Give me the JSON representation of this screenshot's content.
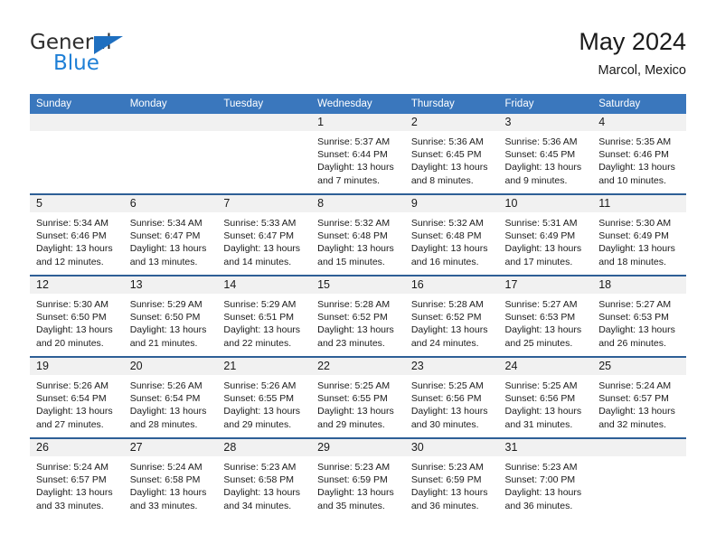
{
  "brand": {
    "name_part1": "General",
    "name_part2": "Blue",
    "triangle_icon": "triangle-logo-icon",
    "color_dark": "#2e2e2e",
    "color_blue": "#1e7fd6"
  },
  "header": {
    "title": "May 2024",
    "subtitle": "Marcol, Mexico"
  },
  "theme": {
    "header_bg": "#3a77bd",
    "row_rule": "#2e5f96",
    "daynum_band": "#f1f1f1",
    "page_bg": "#ffffff",
    "text": "#1a1a1a"
  },
  "weekdays": [
    "Sunday",
    "Monday",
    "Tuesday",
    "Wednesday",
    "Thursday",
    "Friday",
    "Saturday"
  ],
  "weeks": [
    [
      {
        "day": "",
        "sunrise": "",
        "sunset": "",
        "daylight1": "",
        "daylight2": ""
      },
      {
        "day": "",
        "sunrise": "",
        "sunset": "",
        "daylight1": "",
        "daylight2": ""
      },
      {
        "day": "",
        "sunrise": "",
        "sunset": "",
        "daylight1": "",
        "daylight2": ""
      },
      {
        "day": "1",
        "sunrise": "Sunrise: 5:37 AM",
        "sunset": "Sunset: 6:44 PM",
        "daylight1": "Daylight: 13 hours",
        "daylight2": "and 7 minutes."
      },
      {
        "day": "2",
        "sunrise": "Sunrise: 5:36 AM",
        "sunset": "Sunset: 6:45 PM",
        "daylight1": "Daylight: 13 hours",
        "daylight2": "and 8 minutes."
      },
      {
        "day": "3",
        "sunrise": "Sunrise: 5:36 AM",
        "sunset": "Sunset: 6:45 PM",
        "daylight1": "Daylight: 13 hours",
        "daylight2": "and 9 minutes."
      },
      {
        "day": "4",
        "sunrise": "Sunrise: 5:35 AM",
        "sunset": "Sunset: 6:46 PM",
        "daylight1": "Daylight: 13 hours",
        "daylight2": "and 10 minutes."
      }
    ],
    [
      {
        "day": "5",
        "sunrise": "Sunrise: 5:34 AM",
        "sunset": "Sunset: 6:46 PM",
        "daylight1": "Daylight: 13 hours",
        "daylight2": "and 12 minutes."
      },
      {
        "day": "6",
        "sunrise": "Sunrise: 5:34 AM",
        "sunset": "Sunset: 6:47 PM",
        "daylight1": "Daylight: 13 hours",
        "daylight2": "and 13 minutes."
      },
      {
        "day": "7",
        "sunrise": "Sunrise: 5:33 AM",
        "sunset": "Sunset: 6:47 PM",
        "daylight1": "Daylight: 13 hours",
        "daylight2": "and 14 minutes."
      },
      {
        "day": "8",
        "sunrise": "Sunrise: 5:32 AM",
        "sunset": "Sunset: 6:48 PM",
        "daylight1": "Daylight: 13 hours",
        "daylight2": "and 15 minutes."
      },
      {
        "day": "9",
        "sunrise": "Sunrise: 5:32 AM",
        "sunset": "Sunset: 6:48 PM",
        "daylight1": "Daylight: 13 hours",
        "daylight2": "and 16 minutes."
      },
      {
        "day": "10",
        "sunrise": "Sunrise: 5:31 AM",
        "sunset": "Sunset: 6:49 PM",
        "daylight1": "Daylight: 13 hours",
        "daylight2": "and 17 minutes."
      },
      {
        "day": "11",
        "sunrise": "Sunrise: 5:30 AM",
        "sunset": "Sunset: 6:49 PM",
        "daylight1": "Daylight: 13 hours",
        "daylight2": "and 18 minutes."
      }
    ],
    [
      {
        "day": "12",
        "sunrise": "Sunrise: 5:30 AM",
        "sunset": "Sunset: 6:50 PM",
        "daylight1": "Daylight: 13 hours",
        "daylight2": "and 20 minutes."
      },
      {
        "day": "13",
        "sunrise": "Sunrise: 5:29 AM",
        "sunset": "Sunset: 6:50 PM",
        "daylight1": "Daylight: 13 hours",
        "daylight2": "and 21 minutes."
      },
      {
        "day": "14",
        "sunrise": "Sunrise: 5:29 AM",
        "sunset": "Sunset: 6:51 PM",
        "daylight1": "Daylight: 13 hours",
        "daylight2": "and 22 minutes."
      },
      {
        "day": "15",
        "sunrise": "Sunrise: 5:28 AM",
        "sunset": "Sunset: 6:52 PM",
        "daylight1": "Daylight: 13 hours",
        "daylight2": "and 23 minutes."
      },
      {
        "day": "16",
        "sunrise": "Sunrise: 5:28 AM",
        "sunset": "Sunset: 6:52 PM",
        "daylight1": "Daylight: 13 hours",
        "daylight2": "and 24 minutes."
      },
      {
        "day": "17",
        "sunrise": "Sunrise: 5:27 AM",
        "sunset": "Sunset: 6:53 PM",
        "daylight1": "Daylight: 13 hours",
        "daylight2": "and 25 minutes."
      },
      {
        "day": "18",
        "sunrise": "Sunrise: 5:27 AM",
        "sunset": "Sunset: 6:53 PM",
        "daylight1": "Daylight: 13 hours",
        "daylight2": "and 26 minutes."
      }
    ],
    [
      {
        "day": "19",
        "sunrise": "Sunrise: 5:26 AM",
        "sunset": "Sunset: 6:54 PM",
        "daylight1": "Daylight: 13 hours",
        "daylight2": "and 27 minutes."
      },
      {
        "day": "20",
        "sunrise": "Sunrise: 5:26 AM",
        "sunset": "Sunset: 6:54 PM",
        "daylight1": "Daylight: 13 hours",
        "daylight2": "and 28 minutes."
      },
      {
        "day": "21",
        "sunrise": "Sunrise: 5:26 AM",
        "sunset": "Sunset: 6:55 PM",
        "daylight1": "Daylight: 13 hours",
        "daylight2": "and 29 minutes."
      },
      {
        "day": "22",
        "sunrise": "Sunrise: 5:25 AM",
        "sunset": "Sunset: 6:55 PM",
        "daylight1": "Daylight: 13 hours",
        "daylight2": "and 29 minutes."
      },
      {
        "day": "23",
        "sunrise": "Sunrise: 5:25 AM",
        "sunset": "Sunset: 6:56 PM",
        "daylight1": "Daylight: 13 hours",
        "daylight2": "and 30 minutes."
      },
      {
        "day": "24",
        "sunrise": "Sunrise: 5:25 AM",
        "sunset": "Sunset: 6:56 PM",
        "daylight1": "Daylight: 13 hours",
        "daylight2": "and 31 minutes."
      },
      {
        "day": "25",
        "sunrise": "Sunrise: 5:24 AM",
        "sunset": "Sunset: 6:57 PM",
        "daylight1": "Daylight: 13 hours",
        "daylight2": "and 32 minutes."
      }
    ],
    [
      {
        "day": "26",
        "sunrise": "Sunrise: 5:24 AM",
        "sunset": "Sunset: 6:57 PM",
        "daylight1": "Daylight: 13 hours",
        "daylight2": "and 33 minutes."
      },
      {
        "day": "27",
        "sunrise": "Sunrise: 5:24 AM",
        "sunset": "Sunset: 6:58 PM",
        "daylight1": "Daylight: 13 hours",
        "daylight2": "and 33 minutes."
      },
      {
        "day": "28",
        "sunrise": "Sunrise: 5:23 AM",
        "sunset": "Sunset: 6:58 PM",
        "daylight1": "Daylight: 13 hours",
        "daylight2": "and 34 minutes."
      },
      {
        "day": "29",
        "sunrise": "Sunrise: 5:23 AM",
        "sunset": "Sunset: 6:59 PM",
        "daylight1": "Daylight: 13 hours",
        "daylight2": "and 35 minutes."
      },
      {
        "day": "30",
        "sunrise": "Sunrise: 5:23 AM",
        "sunset": "Sunset: 6:59 PM",
        "daylight1": "Daylight: 13 hours",
        "daylight2": "and 36 minutes."
      },
      {
        "day": "31",
        "sunrise": "Sunrise: 5:23 AM",
        "sunset": "Sunset: 7:00 PM",
        "daylight1": "Daylight: 13 hours",
        "daylight2": "and 36 minutes."
      },
      {
        "day": "",
        "sunrise": "",
        "sunset": "",
        "daylight1": "",
        "daylight2": ""
      }
    ]
  ]
}
